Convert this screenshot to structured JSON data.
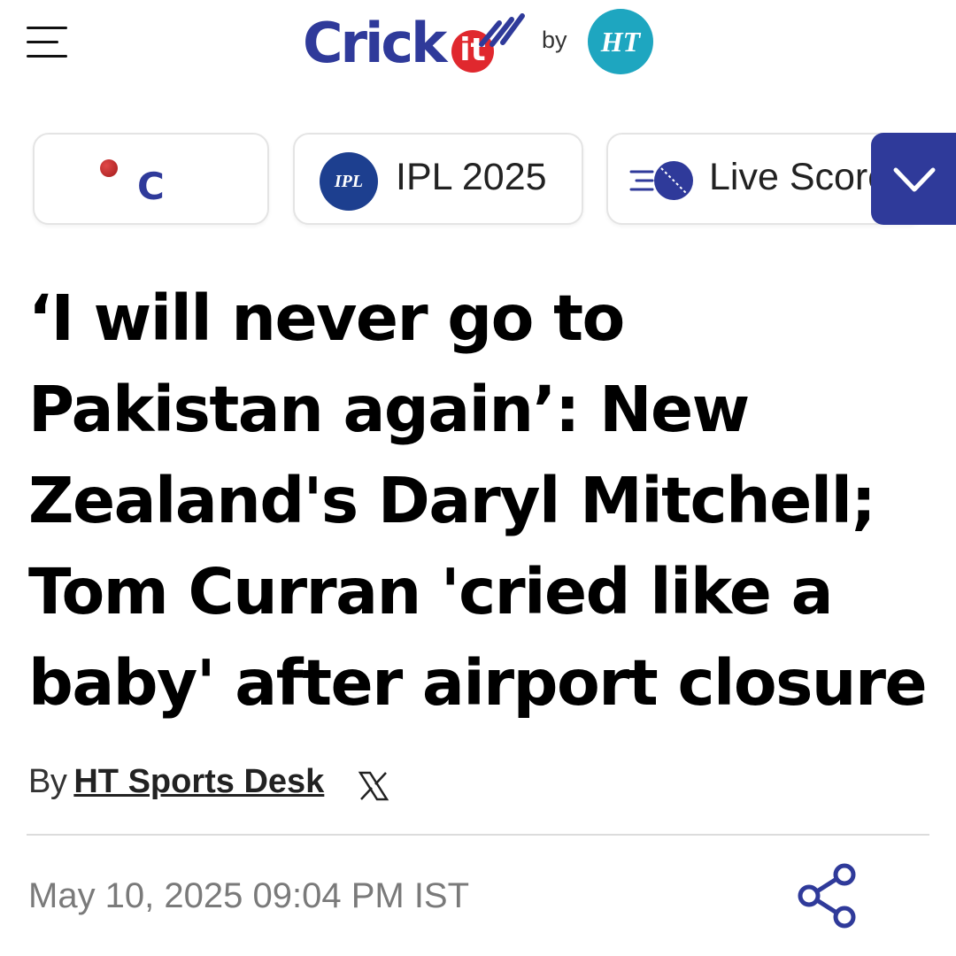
{
  "header": {
    "menu_icon": "hamburger-menu-icon",
    "logo_text": "Crick",
    "logo_badge": "it",
    "by": "by",
    "ht_badge": "HT"
  },
  "nav_chips": [
    {
      "label": "C",
      "icon": "cricket-ball-icon"
    },
    {
      "label": "IPL 2025",
      "icon": "ipl-logo-icon",
      "icon_text": "IPL"
    },
    {
      "label": "Live Score",
      "icon": "live-cricket-ball-icon"
    }
  ],
  "dropdown_icon": "chevron-down-icon",
  "article": {
    "headline": "‘I will never go to Pakistan again’: New Zealand's Daryl Mitchell; Tom Curran 'cried like a baby' after airport closure",
    "byline_prefix": "By",
    "author": "HT Sports Desk",
    "author_social_icon": "x-twitter-icon",
    "timestamp": "May 10, 2025 09:04 PM IST",
    "share_icon": "share-icon"
  },
  "colors": {
    "brand_blue": "#2f3a9a",
    "brand_red": "#e0282e",
    "ht_teal": "#1ea6c0",
    "ipl_blue": "#1d3f8f",
    "timestamp_gray": "#7a7a7a"
  }
}
